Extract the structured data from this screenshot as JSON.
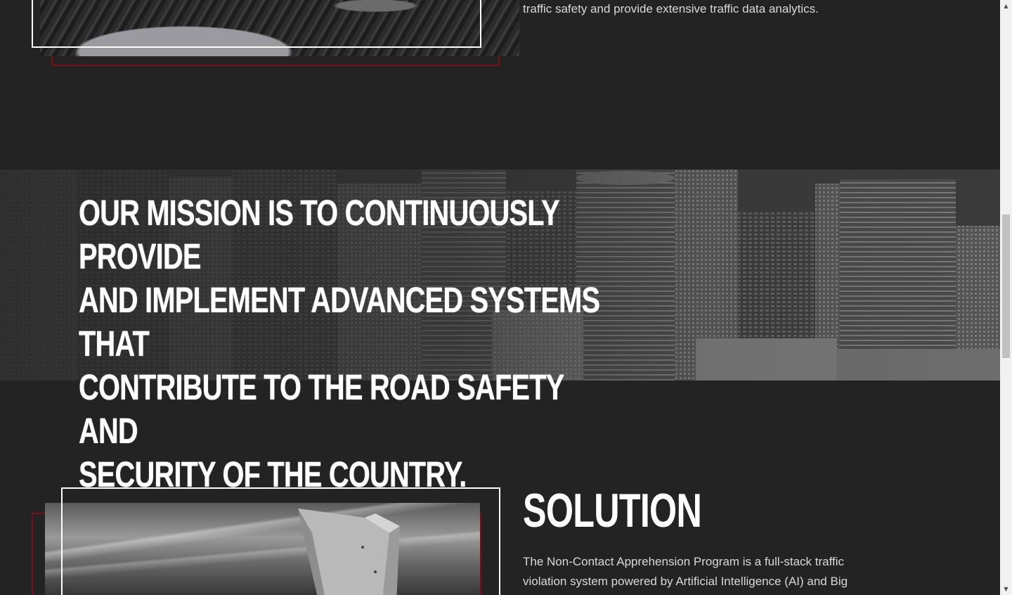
{
  "intro": {
    "text_tail": "traffic safety and provide extensive traffic data analytics."
  },
  "mission": {
    "line1": "OUR MISSION IS TO CONTINUOUSLY PROVIDE",
    "line2": "AND IMPLEMENT ADVANCED SYSTEMS THAT",
    "line3": "CONTRIBUTE TO THE ROAD SAFETY AND",
    "line4": "SECURITY OF THE COUNTRY."
  },
  "solution": {
    "heading": "SOLUTION",
    "body": "The Non-Contact Apprehension Program is a full-stack traffic violation system powered by Artificial Intelligence (AI) and Big"
  },
  "colors": {
    "background": "#232323",
    "accent_red": "#7a0e14",
    "text": "#ffffff",
    "body_text": "#d9d9d9"
  },
  "scrollbar": {
    "up_icon": "scroll-up-arrow-icon",
    "down_icon": "scroll-down-arrow-icon"
  }
}
